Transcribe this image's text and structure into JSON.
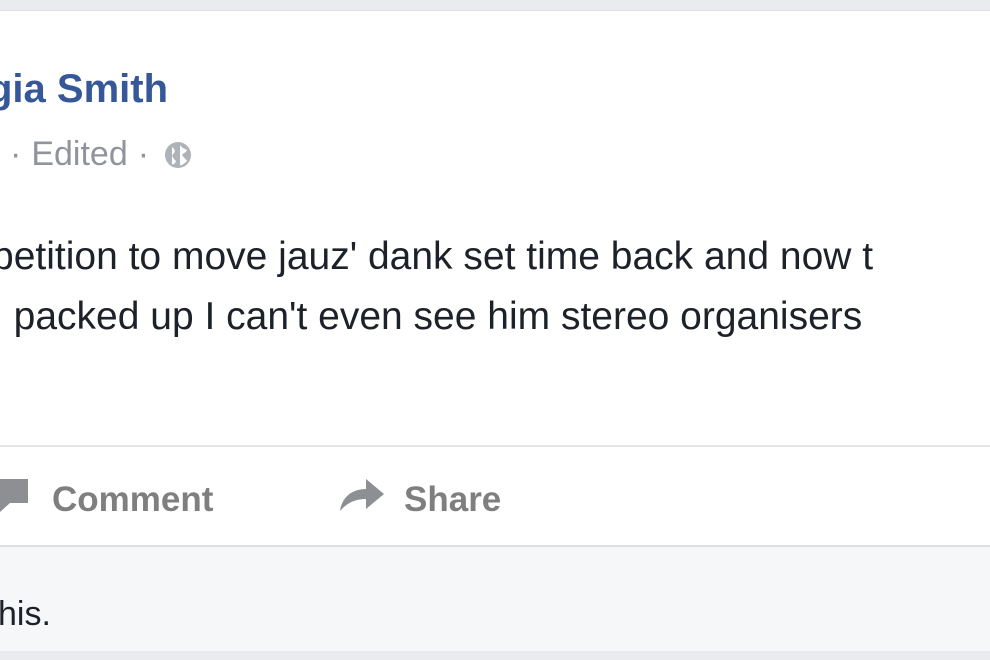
{
  "post": {
    "author": "gia Smith",
    "meta": {
      "sep_left": "·",
      "edited": "Edited",
      "sep_right": "·",
      "privacy_icon": "globe-icon"
    },
    "text_lines": [
      "petition to move jauz' dank set time back and now t",
      "; packed up I can't even see him stereo organisers"
    ]
  },
  "actions": {
    "comment_label": "Comment",
    "comment_icon": "comment-bubble-icon",
    "share_label": "Share",
    "share_icon": "share-arrow-icon"
  },
  "comments": {
    "text": "his."
  },
  "colors": {
    "author": "#365899",
    "meta": "#90949c",
    "body_text": "#1d2129",
    "action": "#7f7f7f",
    "background": "#e9ebee"
  }
}
